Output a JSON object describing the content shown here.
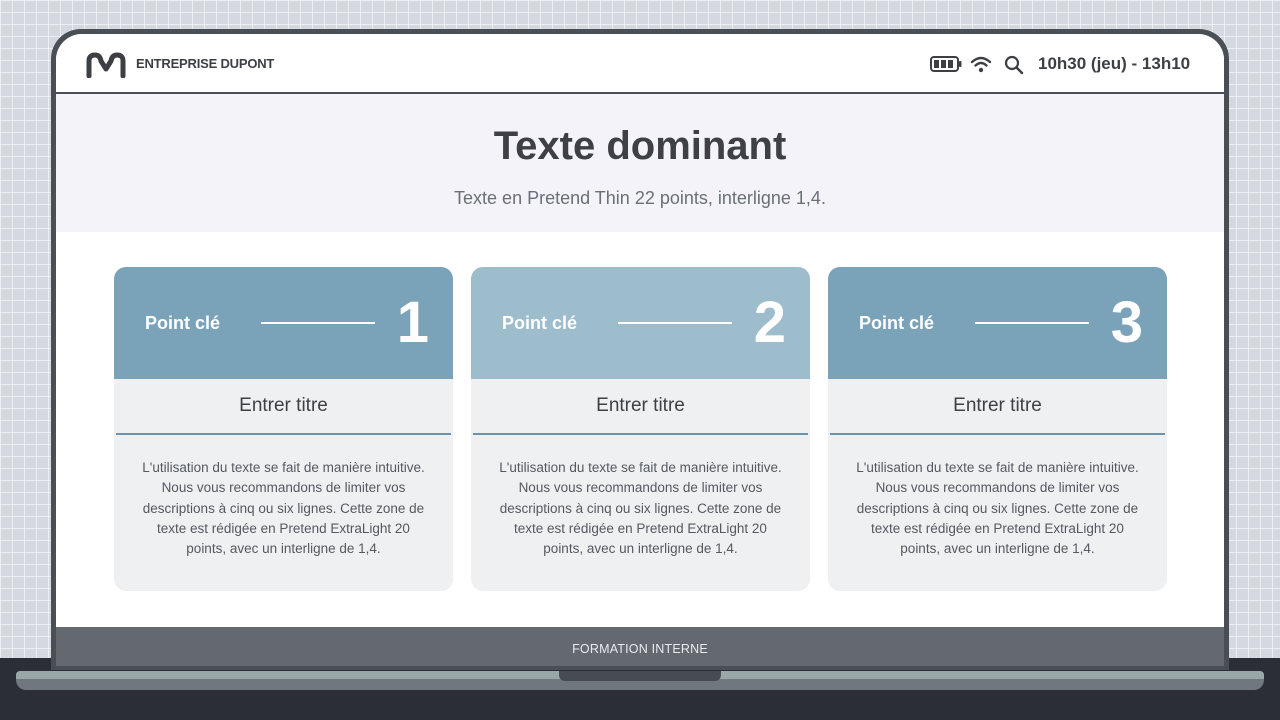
{
  "header": {
    "company_name": "ENTREPRISE DUPONT",
    "time": "10h30 (jeu) - 13h10",
    "icons": [
      "logo-icon",
      "battery-icon",
      "wifi-icon",
      "search-icon"
    ]
  },
  "hero": {
    "title": "Texte dominant",
    "subtitle": "Texte en Pretend Thin 22 points, interligne 1,4."
  },
  "cards": [
    {
      "label": "Point clé",
      "number": "1",
      "title": "Entrer titre",
      "description": "L'utilisation du texte se fait de manière intuitive. Nous vous recommandons de limiter vos descriptions à cinq ou six lignes. Cette zone de texte est rédigée en Pretend ExtraLight 20 points, avec un interligne de 1,4.",
      "header_color": "#7aa3b9"
    },
    {
      "label": "Point clé",
      "number": "2",
      "title": "Entrer titre",
      "description": "L'utilisation du texte se fait de manière intuitive. Nous vous recommandons de limiter vos descriptions à cinq ou six lignes. Cette zone de texte est rédigée en Pretend ExtraLight 20 points, avec un interligne de 1,4.",
      "header_color": "#9dbccc"
    },
    {
      "label": "Point clé",
      "number": "3",
      "title": "Entrer titre",
      "description": "L'utilisation du texte se fait de manière intuitive. Nous vous recommandons de limiter vos descriptions à cinq ou six lignes. Cette zone de texte est rédigée en Pretend ExtraLight 20 points, avec un interligne de 1,4.",
      "header_color": "#7aa3b9"
    }
  ],
  "footer": {
    "text": "FORMATION INTERNE"
  },
  "colors": {
    "accent_line": "#6b93ad",
    "title_text": "#3e4046",
    "footer_bg": "#646970"
  }
}
